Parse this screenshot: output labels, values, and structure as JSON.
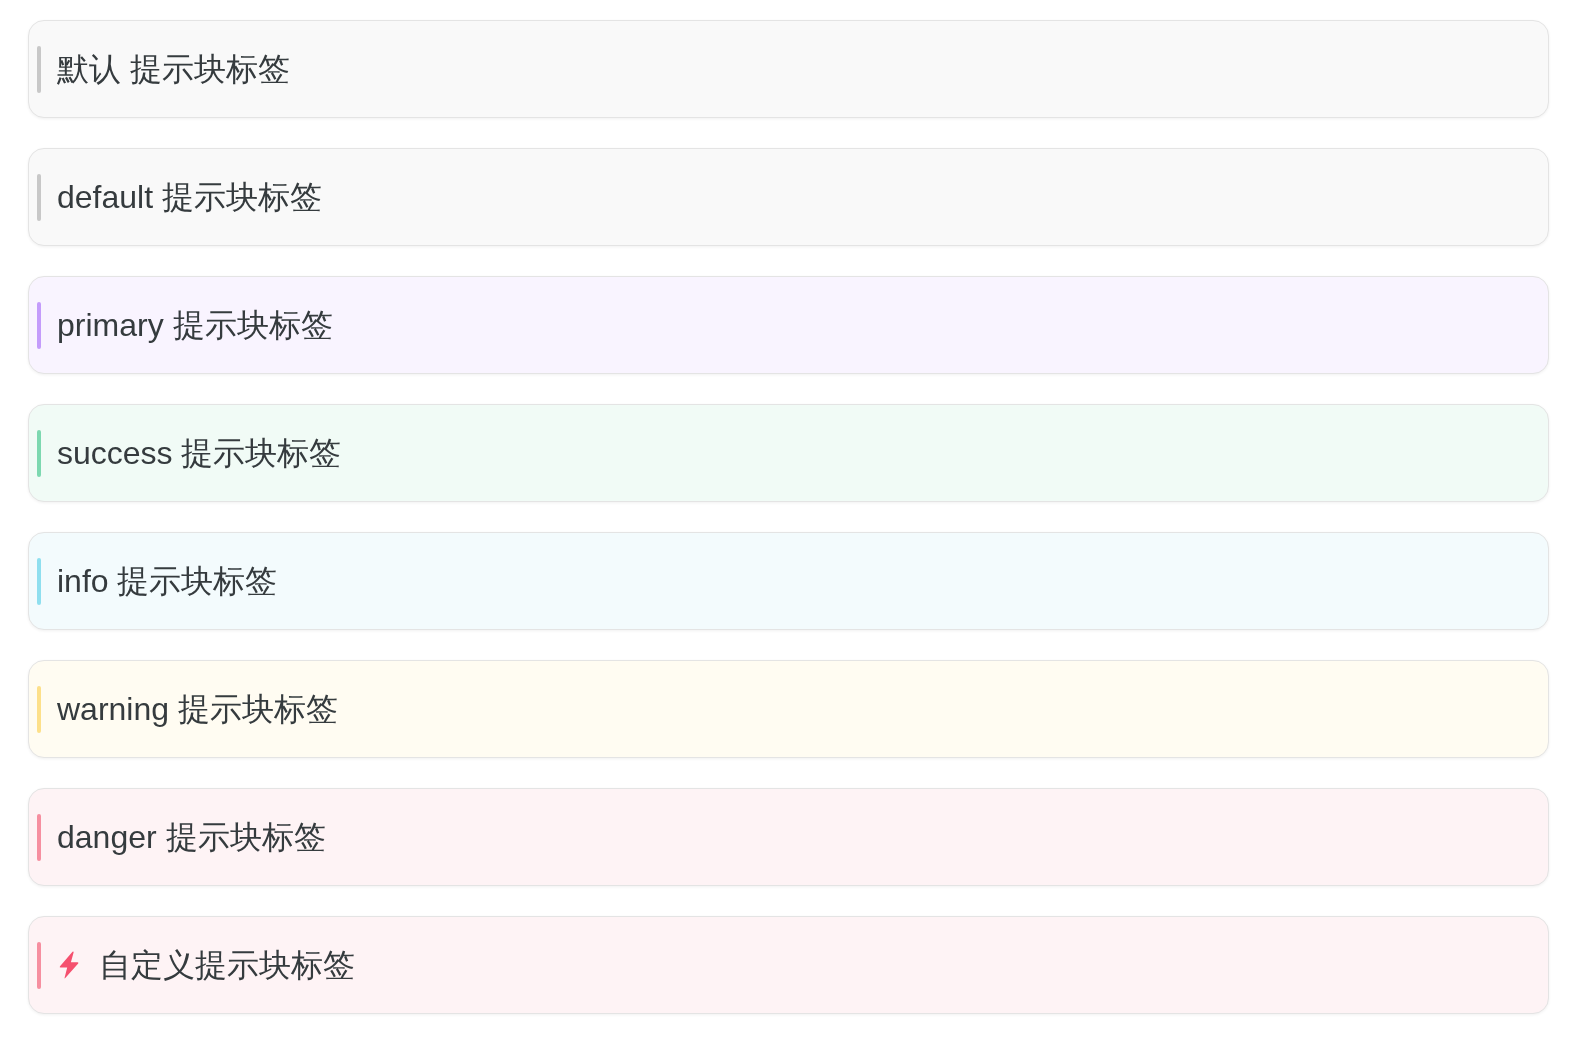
{
  "blocks": [
    {
      "kind": "plain",
      "label": "默认 提示块标签",
      "color": "#c8c8c8"
    },
    {
      "kind": "plain",
      "label": "default 提示块标签",
      "color": "#c8c8c8"
    },
    {
      "kind": "plain",
      "label": "primary 提示块标签",
      "color": "#c49cfb"
    },
    {
      "kind": "plain",
      "label": "success 提示块标签",
      "color": "#7dd8b0"
    },
    {
      "kind": "plain",
      "label": "info 提示块标签",
      "color": "#8fdfef"
    },
    {
      "kind": "plain",
      "label": "warning 提示块标签",
      "color": "#fde08a"
    },
    {
      "kind": "plain",
      "label": "danger 提示块标签",
      "color": "#f68fa0"
    },
    {
      "kind": "icon",
      "label": "自定义提示块标签",
      "color": "#f68fa0"
    }
  ]
}
